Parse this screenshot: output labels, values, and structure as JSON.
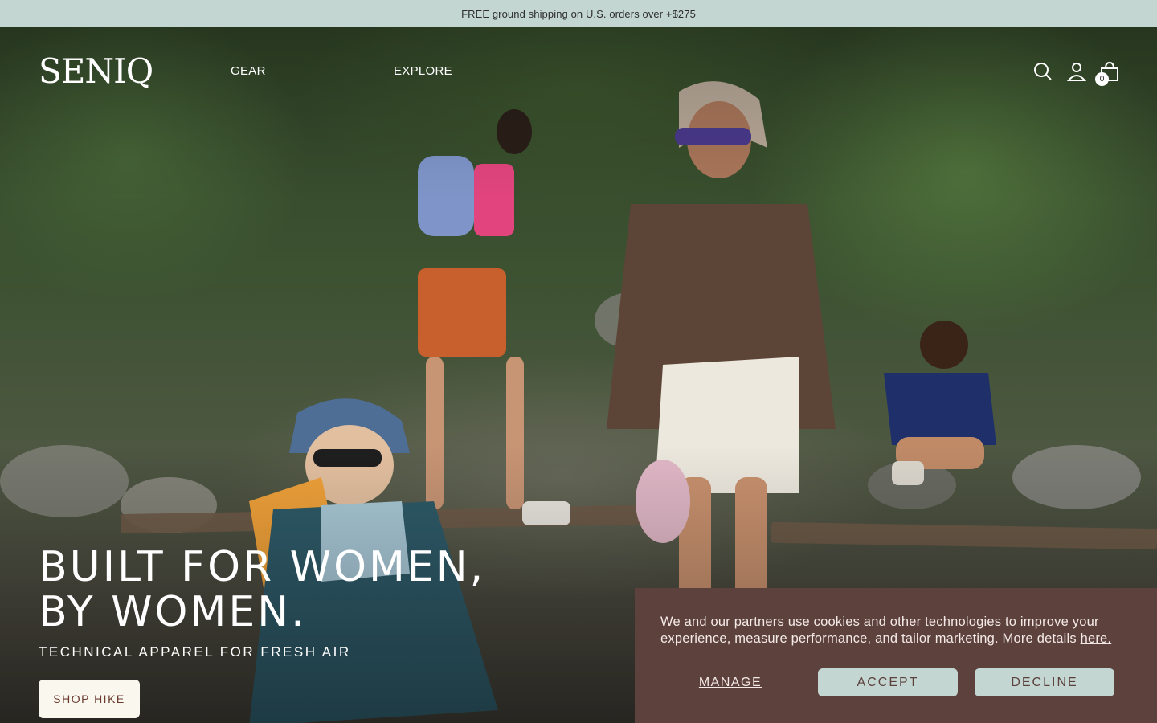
{
  "announcement": {
    "text": "FREE ground shipping on U.S. orders over +$275"
  },
  "header": {
    "logo": "SENIQ",
    "nav": [
      {
        "label": "GEAR"
      },
      {
        "label": "EXPLORE"
      }
    ],
    "icons": [
      "search-icon",
      "account-icon",
      "cart-icon"
    ],
    "cart_count": "0"
  },
  "hero": {
    "headline_line1": "BUILT FOR WOMEN,",
    "headline_line2": "BY WOMEN.",
    "subhead": "TECHNICAL APPAREL FOR FRESH AIR",
    "cta_label": "SHOP HIKE"
  },
  "cookie_banner": {
    "text": "We and our partners use cookies and other technologies to improve your experience, measure performance, and tailor marketing. More details",
    "link_label": "here.",
    "manage_label": "MANAGE",
    "accept_label": "ACCEPT",
    "decline_label": "DECLINE"
  },
  "colors": {
    "announcement_bg": "#c3d6d1",
    "cookie_bg": "#5c413d",
    "button_bg": "#c3d6d1",
    "cta_bg": "#faf7ee"
  }
}
